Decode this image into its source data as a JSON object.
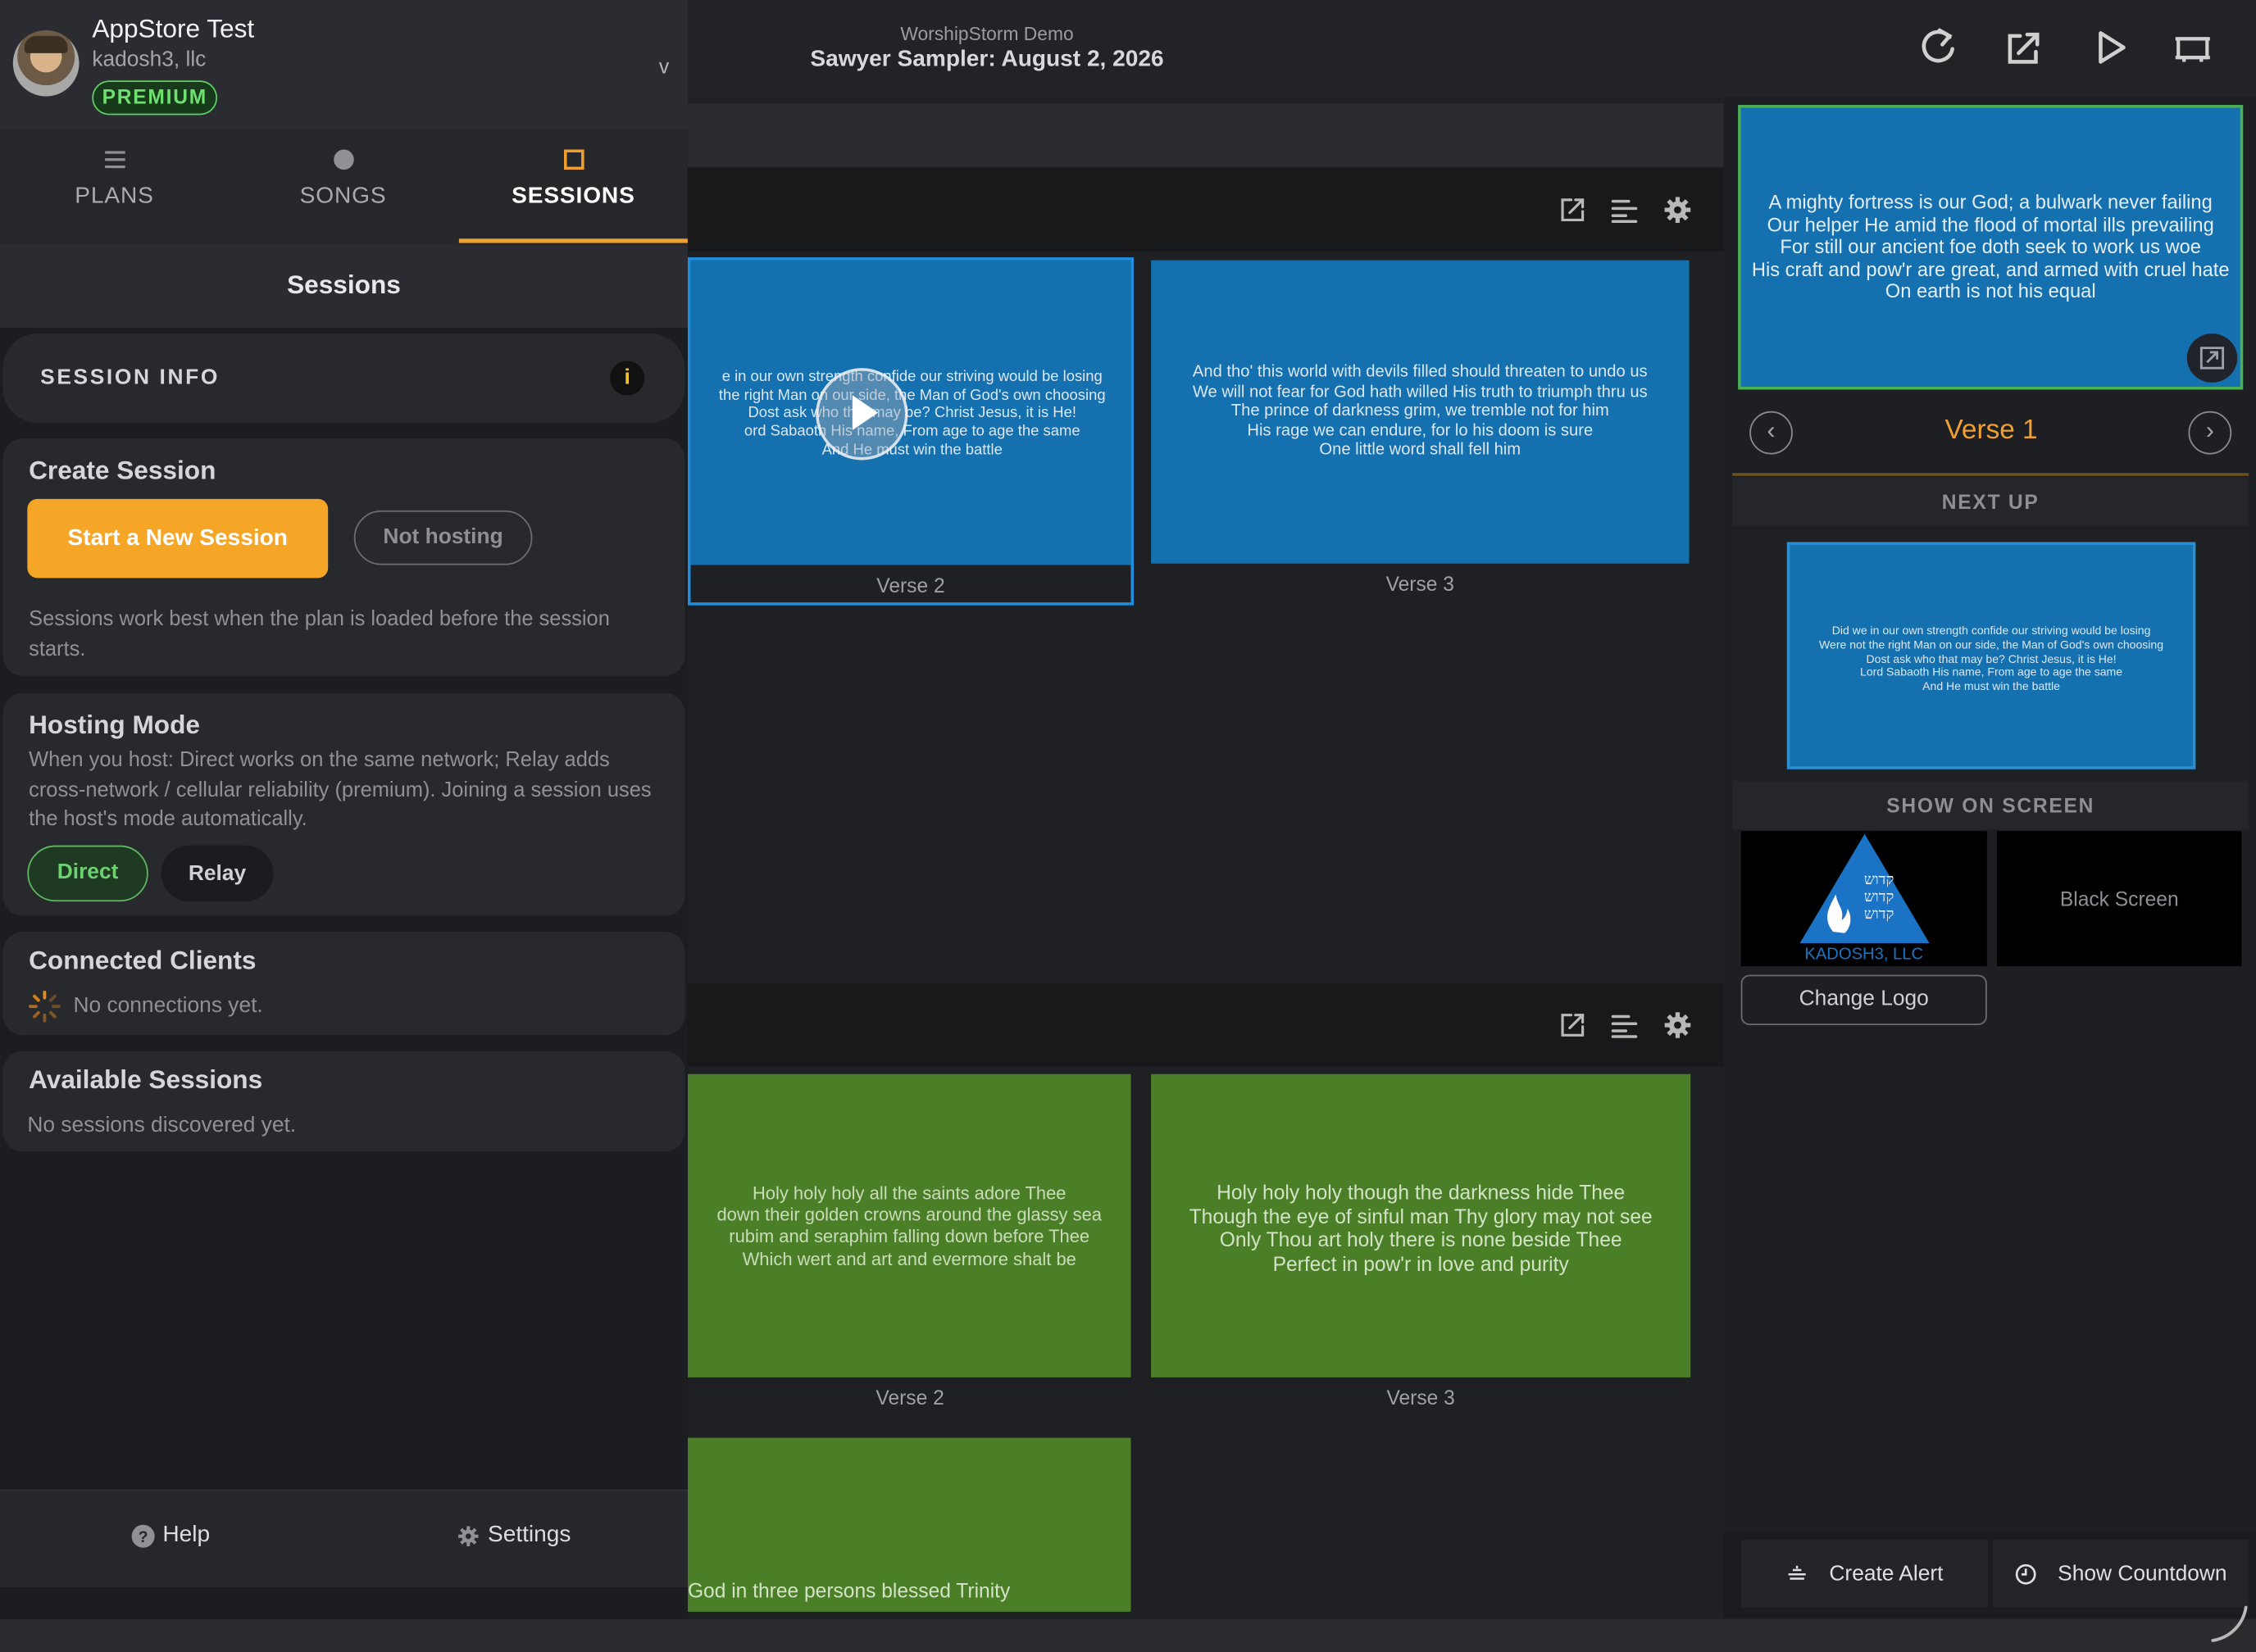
{
  "header": {
    "subtitle": "WorshipStorm Demo",
    "title": "Sawyer Sampler: August 2, 2026"
  },
  "sidebar": {
    "user": {
      "name": "AppStore Test",
      "org": "kadosh3, llc",
      "badge": "PREMIUM",
      "chevron": "v"
    },
    "tabs": [
      {
        "label": "PLANS",
        "icon": "list-icon"
      },
      {
        "label": "SONGS",
        "icon": "dot-icon"
      },
      {
        "label": "SESSIONS",
        "icon": "square-icon",
        "active": true
      }
    ],
    "title": "Sessions",
    "session_info": {
      "label": "SESSION INFO",
      "info_glyph": "i"
    },
    "create_session": {
      "heading": "Create Session",
      "start_label": "Start a New Session",
      "status_label": "Not hosting",
      "note": "Sessions work best when the plan is loaded before the session starts."
    },
    "hosting_mode": {
      "heading": "Hosting Mode",
      "description": "When you host: Direct works on the same network; Relay adds cross-network / cellular reliability (premium). Joining a session uses the host's mode automatically.",
      "options": [
        "Direct",
        "Relay"
      ],
      "selected": "Direct"
    },
    "connected_clients": {
      "heading": "Connected Clients",
      "empty": "No connections yet."
    },
    "available_sessions": {
      "heading": "Available Sessions",
      "empty": "No sessions discovered yet."
    },
    "footer": {
      "help": "Help",
      "settings": "Settings"
    }
  },
  "main": {
    "song1": {
      "slides": [
        {
          "caption": "Verse 2",
          "text": "e in our own strength confide our striving would be losing\nthe right Man on our side, the Man of God's own choosing\nDost ask who that may be? Christ Jesus, it is He!\nord Sabaoth His name, From age to age the same\nAnd He must win the battle"
        },
        {
          "caption": "Verse 3",
          "text": "And tho' this world with devils filled should threaten to undo us\nWe will not fear for God hath willed His truth to triumph thru us\nThe prince of darkness grim, we tremble not for him\nHis rage we can endure, for lo his doom is sure\nOne little word shall fell him"
        }
      ]
    },
    "song2": {
      "slides": [
        {
          "caption": "Verse 2",
          "text": "Holy holy holy all the saints adore Thee\ndown their golden crowns around the glassy sea\nrubim and seraphim falling down before Thee\nWhich wert and art and evermore shalt be"
        },
        {
          "caption": "Verse 3",
          "text": "Holy holy holy though the darkness hide Thee\nThough the eye of sinful man Thy glory may not see\nOnly Thou art holy there is none beside Thee\nPerfect in pow'r in love and purity"
        },
        {
          "caption": "",
          "text": "God in three persons blessed Trinity"
        }
      ]
    }
  },
  "right_panel": {
    "preview_text": "A mighty fortress is our God; a bulwark never failing\nOur helper He amid the flood of mortal ills prevailing\nFor still our ancient foe doth seek to work us woe\nHis craft and pow'r are great, and armed with cruel hate\nOn earth is not his equal",
    "current_label": "Verse 1",
    "next_up_label": "NEXT UP",
    "next_text": "Did we in our own strength confide our striving would be losing\nWere not the right Man on our side, the Man of God's own choosing\nDost ask who that may be? Christ Jesus, it is He!\nLord Sabaoth His name, From age to age the same\nAnd He must win the battle",
    "show_on_screen_label": "SHOW ON SCREEN",
    "logo": {
      "hebrew": "קדוש\nקדוש\nקדוש",
      "caption": "KADOSH3, LLC"
    },
    "black_screen": "Black Screen",
    "change_logo": "Change Logo",
    "create_alert": "Create Alert",
    "show_countdown": "Show Countdown"
  },
  "colors": {
    "accent": "#f5a627",
    "slide_blue": "#1470ae",
    "slide_green": "#4b7f27",
    "active_green": "#5fcf62"
  }
}
